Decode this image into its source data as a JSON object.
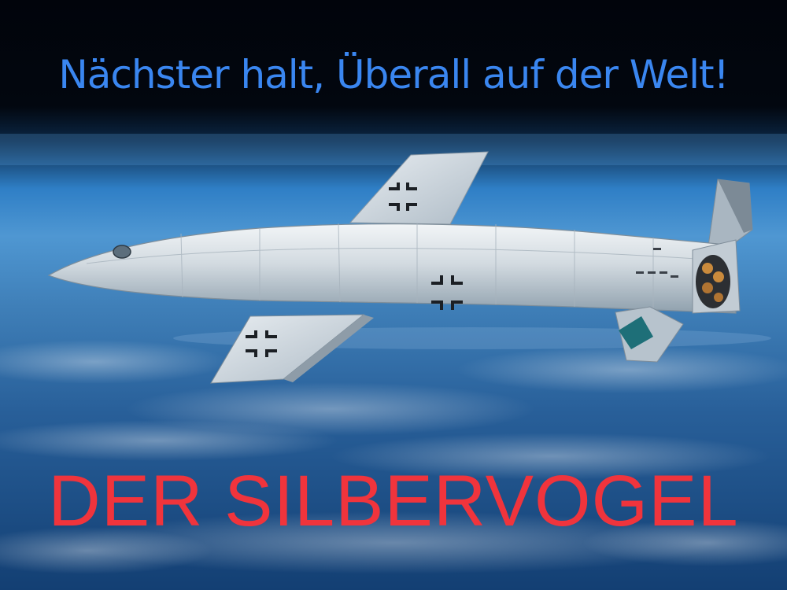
{
  "headline": "Nächster halt, Überall auf der Welt!",
  "title": "DER SILBERVOGEL",
  "colors": {
    "headline": "#3a86f0",
    "title": "#f0343c",
    "space": "#02060f",
    "horizon": "#2f7fc6",
    "ocean": "#1d4f86",
    "fuselage": "#d5dde3"
  },
  "icons": [
    "balkenkreuz-icon",
    "roundel-icon",
    "rocket-nozzle-icon"
  ]
}
